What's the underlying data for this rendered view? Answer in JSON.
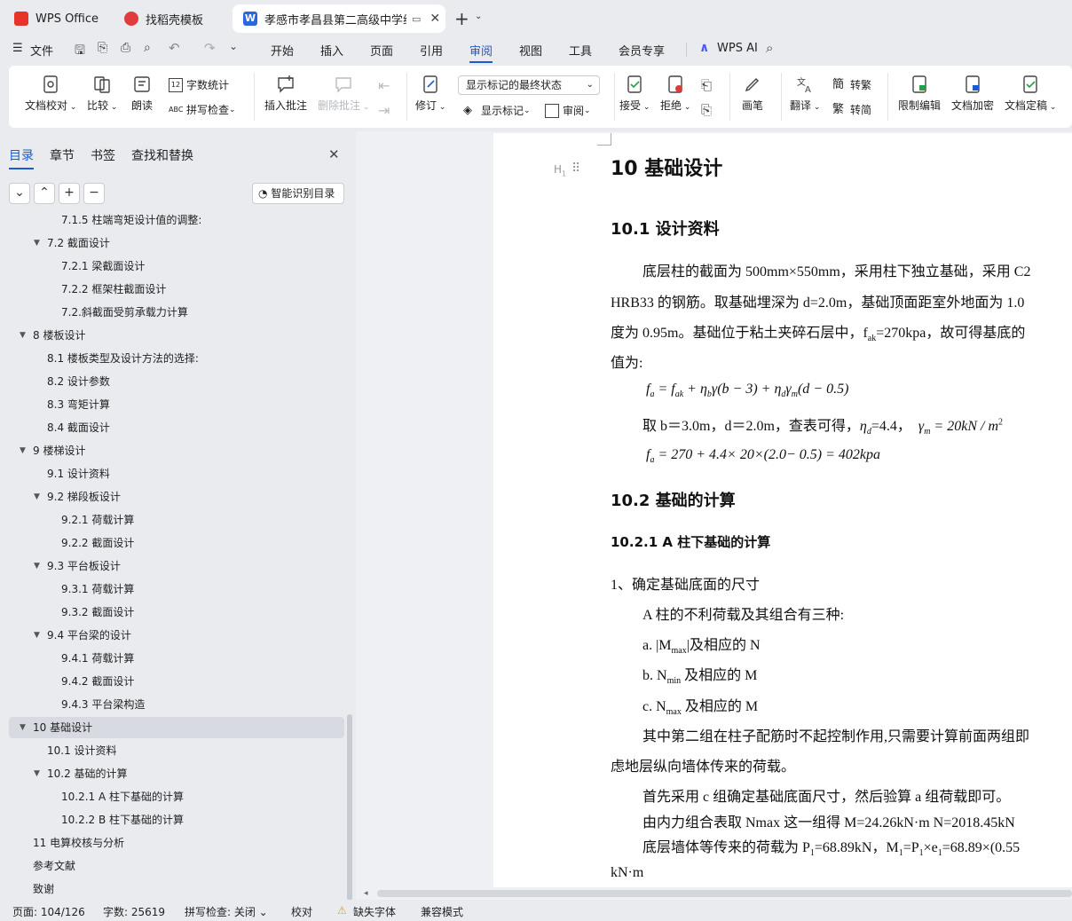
{
  "tabs": [
    {
      "label": "WPS Office",
      "icon": "wps-logo-icon"
    },
    {
      "label": "找稻壳模板",
      "icon": "daoke-logo-icon"
    },
    {
      "label": "孝感市孝昌县第二高级中学综",
      "icon": "writer-doc-icon"
    }
  ],
  "menu": {
    "file": "文件",
    "items": [
      "开始",
      "插入",
      "页面",
      "引用",
      "审阅",
      "视图",
      "工具",
      "会员专享"
    ],
    "active": "审阅",
    "wps_ai": "WPS AI"
  },
  "ribbon": {
    "doc_proof": "文档校对",
    "compare": "比较",
    "read_aloud": "朗读",
    "word_count": "字数统计",
    "spell_check": "拼写检查",
    "insert_comment": "插入批注",
    "delete_comment": "删除批注",
    "track_changes": "修订",
    "markup_state": "显示标记的最终状态",
    "show_markup": "显示标记",
    "review": "审阅",
    "accept": "接受",
    "reject": "拒绝",
    "pen": "画笔",
    "translate": "翻译",
    "to_traditional": "转繁",
    "to_simplified": "转简",
    "restrict_edit": "限制编辑",
    "encrypt": "文档加密",
    "finalize": "文档定稿"
  },
  "sidebar": {
    "tabs": [
      "目录",
      "章节",
      "书签",
      "查找和替换"
    ],
    "smart_toc": "智能识别目录",
    "toc": [
      {
        "label": "7.1.5 柱端弯矩设计值的调整:",
        "level": 3,
        "arrow": ""
      },
      {
        "label": "7.2 截面设计",
        "level": 2,
        "arrow": "▼"
      },
      {
        "label": "7.2.1 梁截面设计",
        "level": 3,
        "arrow": ""
      },
      {
        "label": "7.2.2 框架柱截面设计",
        "level": 3,
        "arrow": ""
      },
      {
        "label": "7.2.斜截面受剪承载力计算",
        "level": 3,
        "arrow": ""
      },
      {
        "label": "8  楼板设计",
        "level": 1,
        "arrow": "▼"
      },
      {
        "label": "8.1 楼板类型及设计方法的选择:",
        "level": 2,
        "arrow": ""
      },
      {
        "label": "8.2 设计参数",
        "level": 2,
        "arrow": ""
      },
      {
        "label": "8.3 弯矩计算",
        "level": 2,
        "arrow": ""
      },
      {
        "label": "8.4 截面设计",
        "level": 2,
        "arrow": ""
      },
      {
        "label": "9  楼梯设计",
        "level": 1,
        "arrow": "▼"
      },
      {
        "label": "9.1 设计资料",
        "level": 2,
        "arrow": ""
      },
      {
        "label": "9.2 梯段板设计",
        "level": 2,
        "arrow": "▼"
      },
      {
        "label": "9.2.1 荷载计算",
        "level": 3,
        "arrow": ""
      },
      {
        "label": "9.2.2 截面设计",
        "level": 3,
        "arrow": ""
      },
      {
        "label": "9.3 平台板设计",
        "level": 2,
        "arrow": "▼"
      },
      {
        "label": "9.3.1 荷载计算",
        "level": 3,
        "arrow": ""
      },
      {
        "label": "9.3.2 截面设计",
        "level": 3,
        "arrow": ""
      },
      {
        "label": "9.4 平台梁的设计",
        "level": 2,
        "arrow": "▼"
      },
      {
        "label": "9.4.1 荷载计算",
        "level": 3,
        "arrow": ""
      },
      {
        "label": "9.4.2 截面设计",
        "level": 3,
        "arrow": ""
      },
      {
        "label": "9.4.3 平台梁构造",
        "level": 3,
        "arrow": ""
      },
      {
        "label": "10  基础设计",
        "level": 1,
        "arrow": "▼"
      },
      {
        "label": "10.1 设计资料",
        "level": 2,
        "arrow": ""
      },
      {
        "label": "10.2 基础的计算",
        "level": 2,
        "arrow": "▼"
      },
      {
        "label": "10.2.1 A 柱下基础的计算",
        "level": 3,
        "arrow": ""
      },
      {
        "label": "10.2.2 B 柱下基础的计算",
        "level": 3,
        "arrow": ""
      },
      {
        "label": "11  电算校核与分析",
        "level": 1,
        "arrow": ""
      },
      {
        "label": "参考文献",
        "level": 1,
        "arrow": ""
      },
      {
        "label": "致谢",
        "level": 1,
        "arrow": ""
      }
    ]
  },
  "doc": {
    "heading_marker": "H",
    "h1": "10  基础设计",
    "h2_1": "10.1 设计资料",
    "p1_l1": "底层柱的截面为 500mm×550mm，采用柱下独立基础，采用 C2",
    "p1_l2": "HRB33 的钢筋。取基础埋深为 d=2.0m，基础顶面距室外地面为 1.0",
    "p1_l3_a": "度为 0.95m。基础位于粘土夹碎石层中，f",
    "p1_l3_sub": "ak",
    "p1_l3_b": "=270kpa，故可得基底的",
    "p1_l4": "值为:",
    "eq1": "f",
    "eq1_rest": " = f",
    "eq1_rest2": " + η",
    "eq1_rest3": "γ(b − 3) + η",
    "eq1_rest4": "γ",
    "eq1_rest5": "(d − 0.5)",
    "take": "取 b＝3.0m，d＝2.0m，查表可得，",
    "eta_d": "η",
    "eta_val": "=4.4，",
    "gamma_m": "γ",
    "gamma_val": " = 20kN / m",
    "eq2": "f",
    "eq2_rest": " = 270 + 4.4× 20×(2.0− 0.5) = 402kpa",
    "h2_2": "10.2 基础的计算",
    "h3_1": "10.2.1 A 柱下基础的计算",
    "step1": "1、确定基础底面的尺寸",
    "combo": "A 柱的不利荷载及其组合有三种:",
    "a_pre": "a.   |M",
    "a_sub": "max",
    "a_post": "|及相应的 N",
    "b_pre": "b.   N",
    "b_sub": "min",
    "b_post": " 及相应的 M",
    "c_pre": "c.   N",
    "c_sub": "max",
    "c_post": " 及相应的 M",
    "p2_l1": "其中第二组在柱子配筋时不起控制作用,只需要计算前面两组即",
    "p2_l2": "虑地层纵向墙体传来的荷载。",
    "p3": "首先采用 c 组确定基础底面尺寸，然后验算 a 组荷载即可。",
    "p4": "由内力组合表取 Nmax 这一组得 M=24.26kN·m      N=2018.45kN",
    "p5_a": "底层墙体等传来的荷载为 P",
    "p5_b": "=68.89kN，M",
    "p5_c": "=P",
    "p5_d": "×e",
    "p5_e": "=68.89×(0.55",
    "p5_sub": "1",
    "p6": "kN·m"
  },
  "status": {
    "page": "页面: 104/126",
    "words": "字数: 25619",
    "spell": "拼写检查: 关闭",
    "proof": "校对",
    "missing_font": "缺失字体",
    "compat": "兼容模式"
  }
}
